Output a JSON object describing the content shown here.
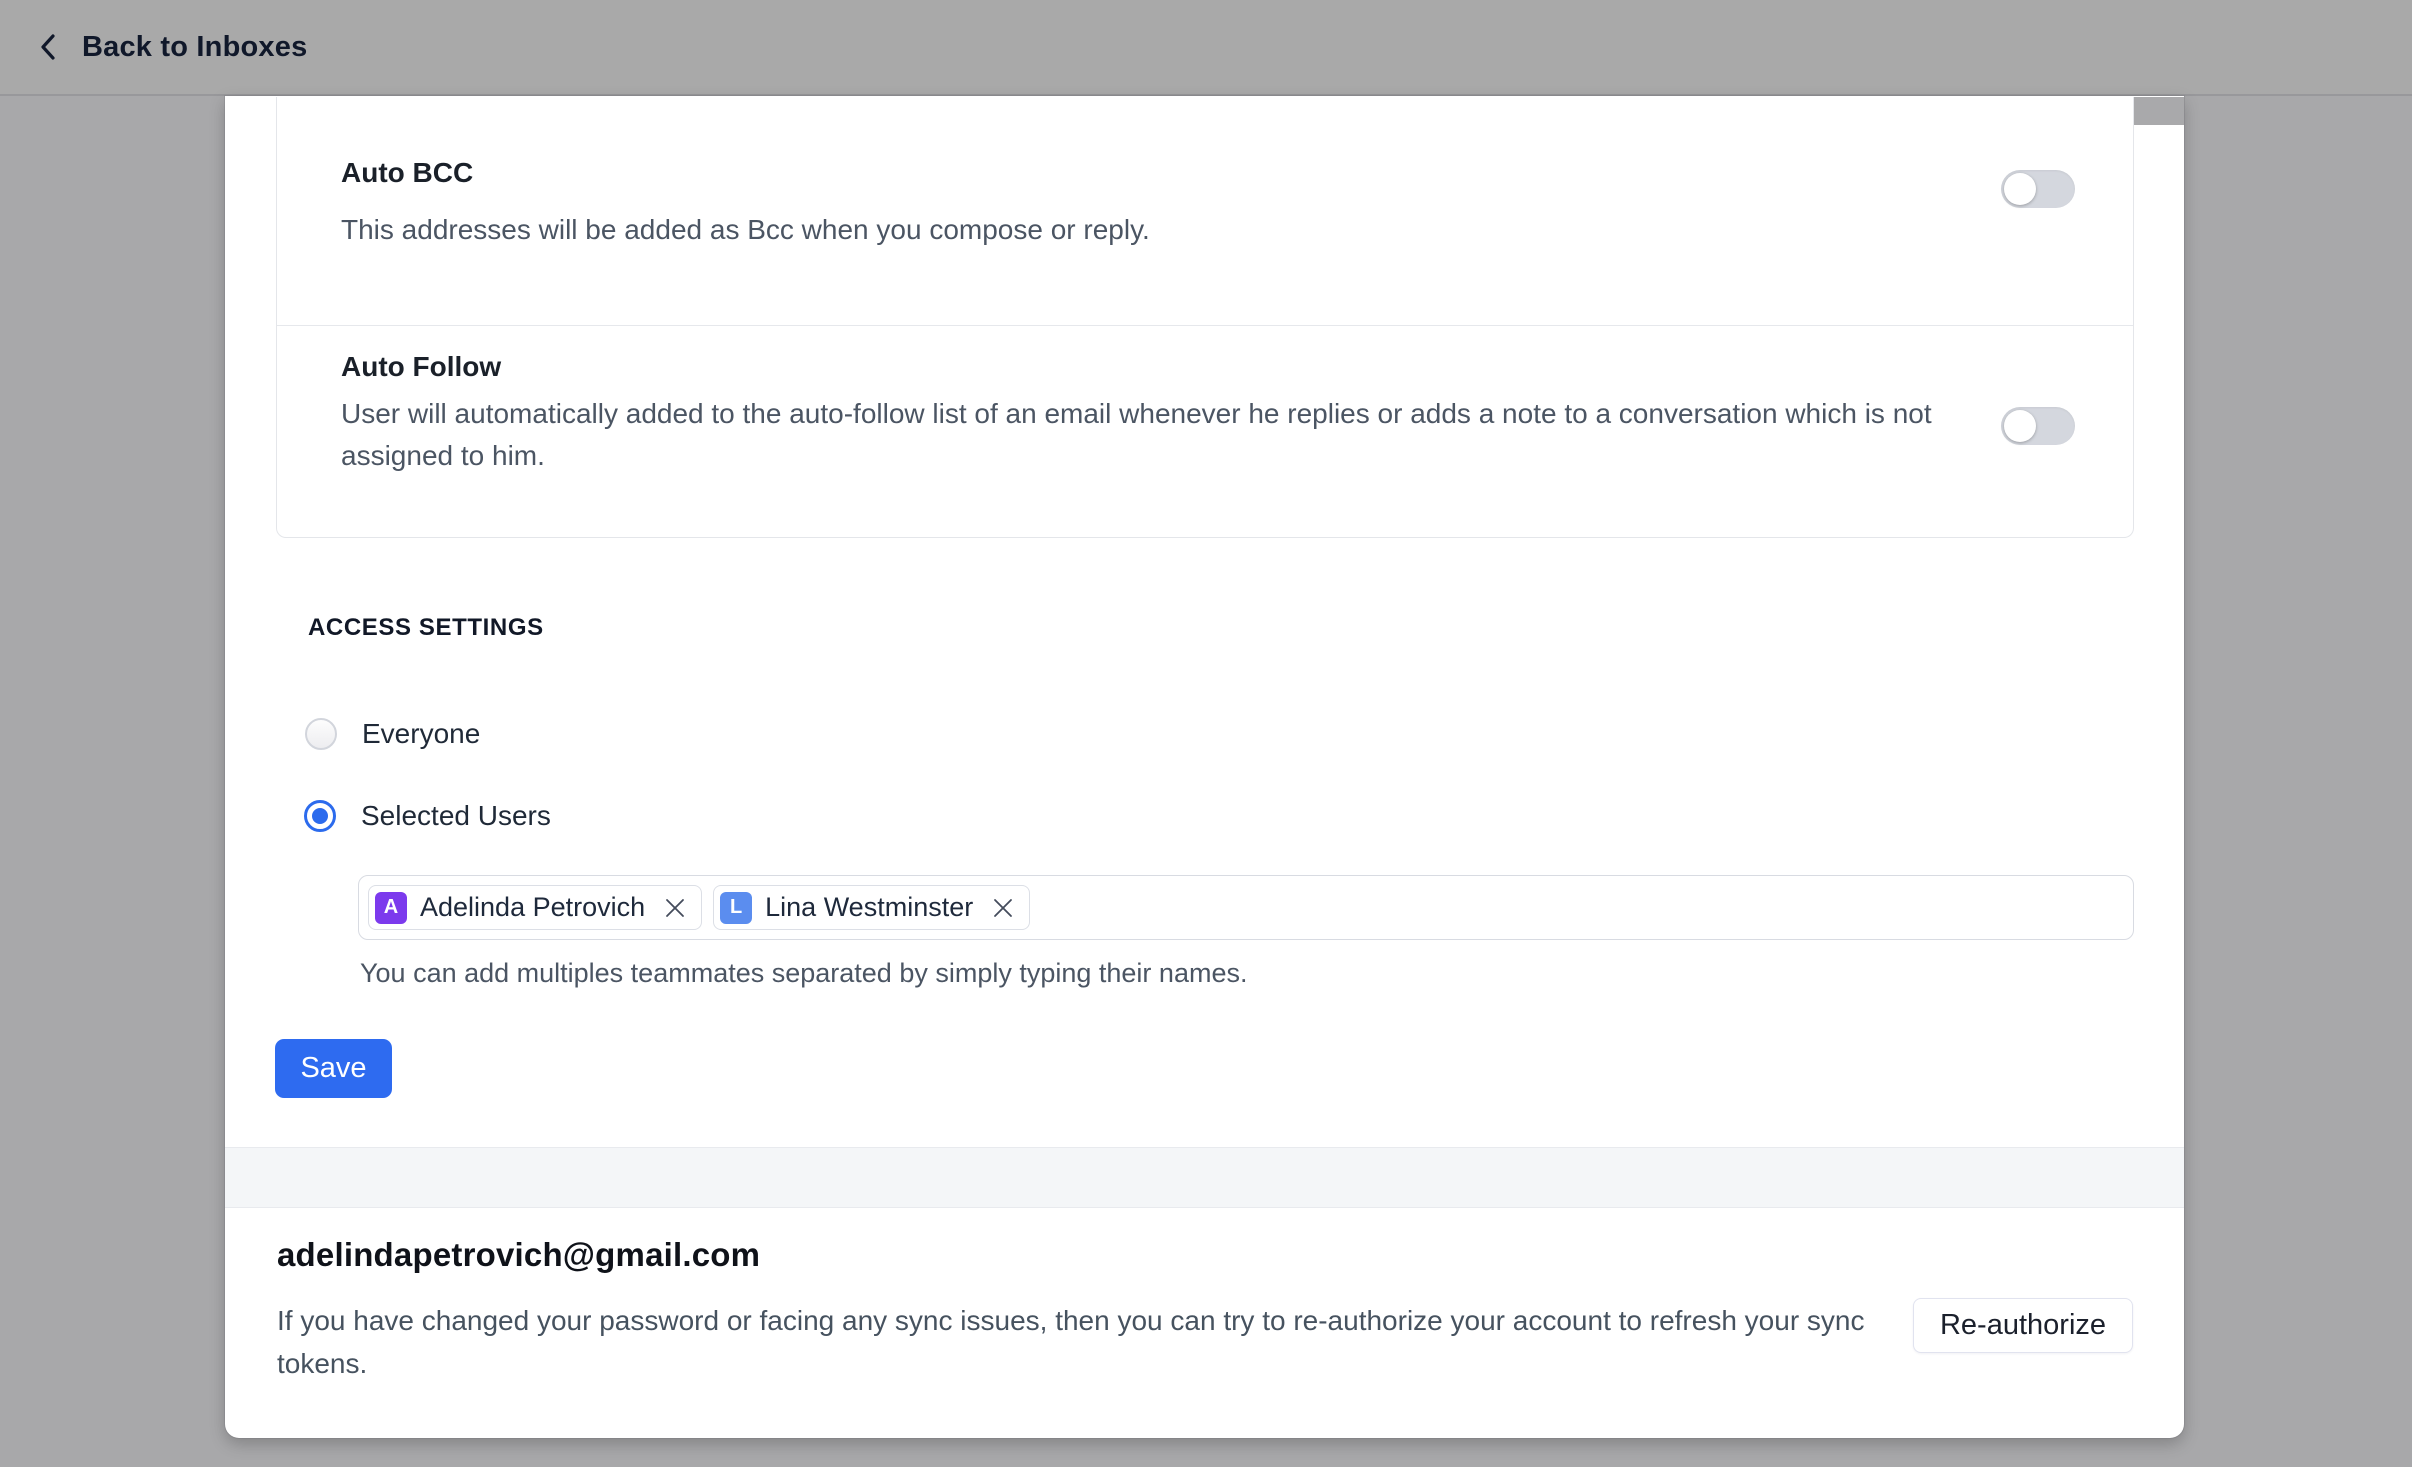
{
  "colors": {
    "page_background": "#a8a8aa",
    "accent_blue": "#2c6bed",
    "save_button_blue": "#2e6bf0",
    "avatar_purple": "#7c3aed",
    "avatar_blue": "#5b8def"
  },
  "header": {
    "back_label": "Back to Inboxes"
  },
  "settings": {
    "auto_bcc": {
      "title": "Auto BCC",
      "description": "This addresses will be added as Bcc when you compose or reply.",
      "enabled": false
    },
    "auto_follow": {
      "title": "Auto Follow",
      "description": "User will automatically added to the auto-follow list of an email whenever he replies or adds a note to a conversation which is not assigned to him.",
      "enabled": false
    }
  },
  "access_settings": {
    "section_title": "ACCESS SETTINGS",
    "options": [
      {
        "label": "Everyone",
        "selected": false
      },
      {
        "label": "Selected Users",
        "selected": true
      }
    ],
    "selected_users": [
      {
        "name": "Adelinda Petrovich",
        "initial": "A",
        "avatar_color": "#7c3aed"
      },
      {
        "name": "Lina Westminster",
        "initial": "L",
        "avatar_color": "#5b8def"
      }
    ],
    "helper_text": "You can add multiples teammates separated by simply typing their names.",
    "save_label": "Save"
  },
  "account": {
    "email": "adelindapetrovich@gmail.com",
    "description": "If you have changed your password or facing any sync issues, then you can try to re-authorize your account to refresh your sync tokens.",
    "reauthorize_label": "Re-authorize"
  }
}
